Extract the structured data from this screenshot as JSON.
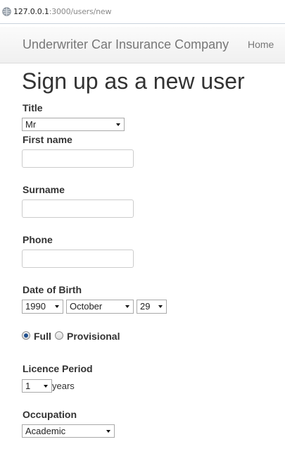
{
  "browser": {
    "url_host": "127.0.0.1",
    "url_rest": ":3000/users/new"
  },
  "navbar": {
    "brand": "Underwriter Car Insurance Company",
    "home": "Home"
  },
  "page": {
    "title": "Sign up as a new user"
  },
  "form": {
    "title": {
      "label": "Title",
      "value": "Mr"
    },
    "first_name": {
      "label": "First name",
      "value": ""
    },
    "surname": {
      "label": "Surname",
      "value": ""
    },
    "phone": {
      "label": "Phone",
      "value": ""
    },
    "dob": {
      "label": "Date of Birth",
      "year": "1990",
      "month": "October",
      "day": "29"
    },
    "licence_type": {
      "options": [
        "Full",
        "Provisional"
      ],
      "selected": "Full"
    },
    "licence_period": {
      "label": "Licence Period",
      "value": "1",
      "unit": "years"
    },
    "occupation": {
      "label": "Occupation",
      "value": "Academic"
    }
  }
}
